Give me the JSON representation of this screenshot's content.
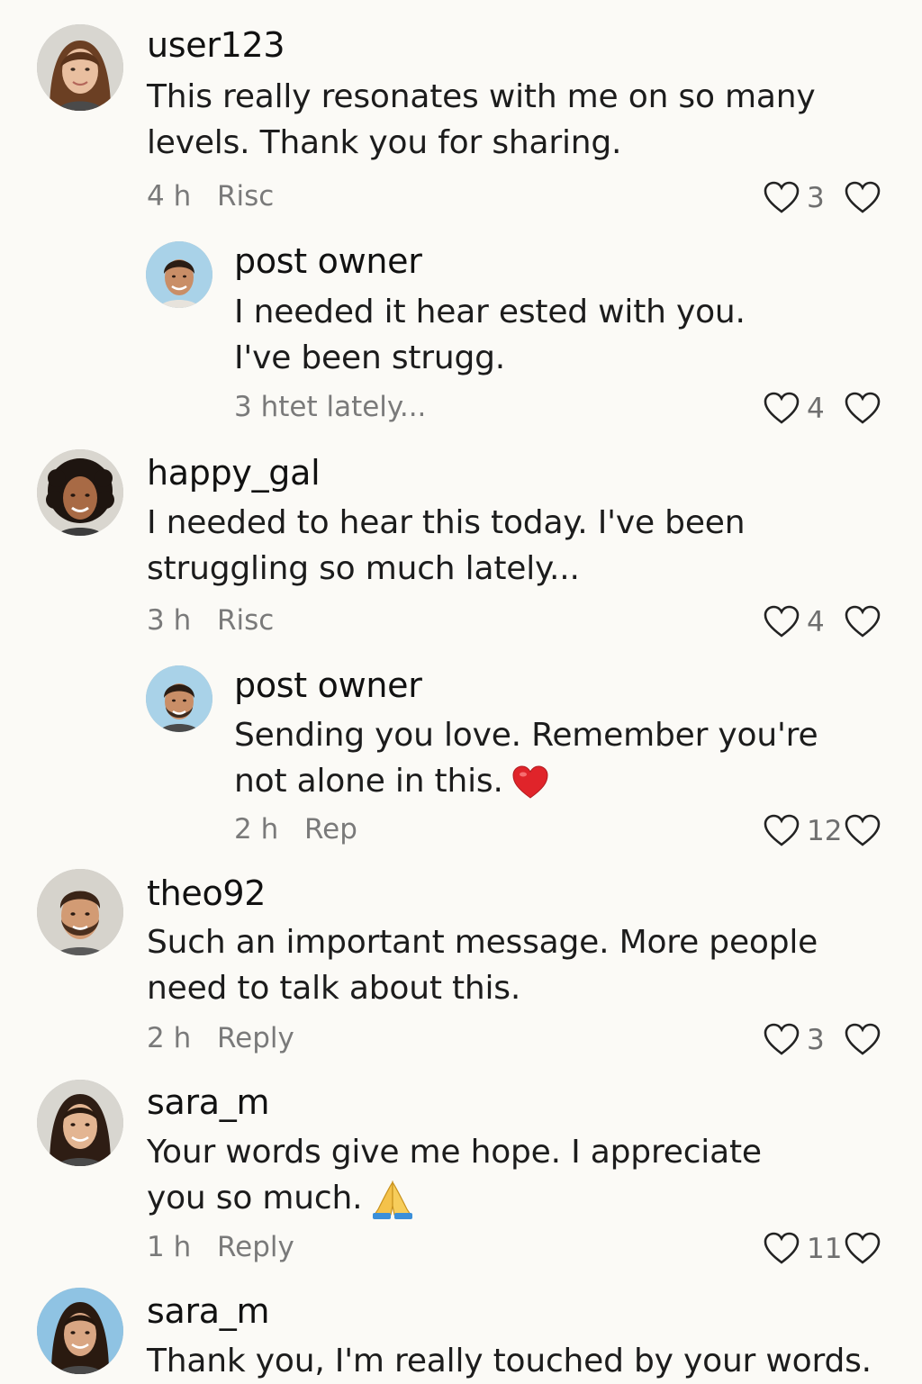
{
  "comments": [
    {
      "username": "user123",
      "line1": "This really resonates with me on so many",
      "line2": "levels. Thank you for sharing.",
      "time": "4 h",
      "reply_label": "Risc",
      "like_count": "3"
    },
    {
      "username": "post owner",
      "line1": "I needed it hear ested with you.",
      "line2": "I've been strugg.",
      "meta_text": "3 htet lately...",
      "like_count": "4"
    },
    {
      "username": "happy_gal",
      "line1": "I needed to hear this today. I've been",
      "line2": "struggling so much lately...",
      "time": "3 h",
      "reply_label": "Risc",
      "like_count": "4"
    },
    {
      "username": "post owner",
      "line1": "Sending you love. Remember you're",
      "line2": "not alone in this.",
      "time": "2 h",
      "reply_label": "Rep",
      "like_count": "12"
    },
    {
      "username": "theo92",
      "line1": "Such an important message. More people",
      "line2": "need to talk about this.",
      "time": "2 h",
      "reply_label": "Reply",
      "like_count": "3"
    },
    {
      "username": "sara_m",
      "line1": "Your words give me hope. I appreciate",
      "line2": "you so much.",
      "time": "1 h",
      "reply_label": "Reply",
      "like_count": "11"
    },
    {
      "username": "sara_m",
      "line1": "Thank you, I'm really touched by your words."
    }
  ],
  "icons": {
    "heart": "heart-outline-icon",
    "red_heart_emoji": "red-heart-emoji",
    "pray_emoji": "folded-hands-emoji"
  },
  "colors": {
    "background": "#fbfaf6",
    "text": "#1b1b1b",
    "meta": "#7a7a7a",
    "heart_emoji": "#e0242a"
  }
}
